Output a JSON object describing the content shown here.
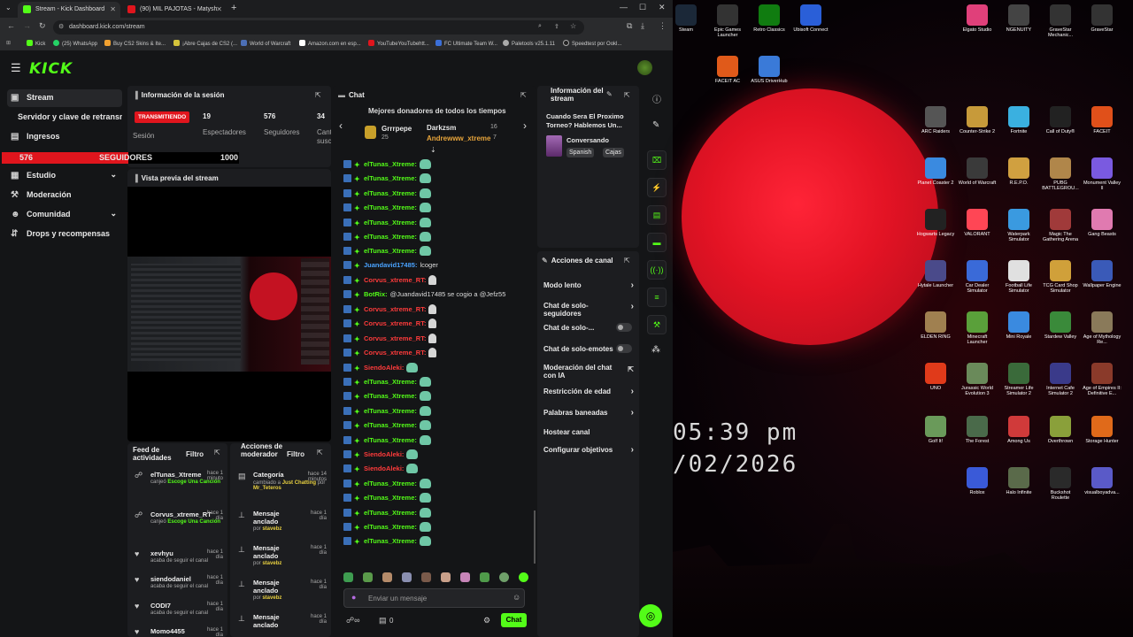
{
  "browser": {
    "tabs": [
      {
        "label": "Stream - Kick Dashboard",
        "active": true
      },
      {
        "label": "(90) MIL PAJOTAS - Matysh",
        "active": false
      }
    ],
    "url": "dashboard.kick.com/stream",
    "bookmarks": [
      "Kick",
      "(25) WhatsApp",
      "Buy CS2 Skins & Ite...",
      "¡Abre Cajas de CS2 (...",
      "World of Warcraft",
      "Amazon.com en esp...",
      "YouTubeYouTubehtt...",
      "FC Ultimate Team W...",
      "Paletools v25.1.11",
      "Speedtest por Ookl..."
    ]
  },
  "sidebar": {
    "items": [
      {
        "label": "Stream",
        "icon": "stream-icon"
      },
      {
        "label": "Servidor y clave de retransmisión",
        "icon": ""
      },
      {
        "label": "Ingresos",
        "icon": "revenue-icon"
      },
      {
        "label": "Estudio",
        "icon": "studio-icon"
      },
      {
        "label": "Moderación",
        "icon": "moderation-icon"
      },
      {
        "label": "Comunidad",
        "icon": "community-icon"
      },
      {
        "label": "Drops y recompensas",
        "icon": "drops-icon"
      }
    ]
  },
  "goal": {
    "current": "576",
    "label": "SEGUIDORES",
    "target": "1000",
    "progress": 0.576
  },
  "session": {
    "title": "Información de la sesión",
    "badge": "TRANSMITIENDO",
    "badge_sub": "Sesión",
    "stats": [
      {
        "value": "19",
        "label": "Espectadores"
      },
      {
        "value": "576",
        "label": "Seguidores"
      },
      {
        "value": "34",
        "label": "Cant suscr"
      }
    ]
  },
  "preview": {
    "title": "Vista previa del stream"
  },
  "feed": {
    "title": "Feed de actividades",
    "filter": "Filtro",
    "items": [
      {
        "name": "elTunas_Xtreme",
        "time": "hace 1 minuto",
        "sub_prefix": "canjeó",
        "sub_hl": "Escoge Una Canción"
      },
      {
        "name": "Corvus_xtreme_RT",
        "time": "hace 1 día",
        "sub_prefix": "canjeó",
        "sub_hl": "Escoge Una Canción"
      },
      {
        "name": "xevhyu",
        "time": "hace 1 día",
        "sub_prefix": "acaba de seguir el canal",
        "sub_hl": ""
      },
      {
        "name": "siendodaniel",
        "time": "hace 1 día",
        "sub_prefix": "acaba de seguir el canal",
        "sub_hl": ""
      },
      {
        "name": "CODI7",
        "time": "hace 1 día",
        "sub_prefix": "acaba de seguir el canal",
        "sub_hl": ""
      },
      {
        "name": "Momo4455",
        "time": "hace 1 día",
        "sub_prefix": "",
        "sub_hl": ""
      }
    ]
  },
  "modactions": {
    "title": "Acciones de moderador",
    "filter": "Filtro",
    "items": [
      {
        "name": "Categoría",
        "time": "hace 14 minutos",
        "sub_a": "cambiado a",
        "sub_b": "Just Chatting",
        "sub_c": "por",
        "sub_d": "Mr_Teteros"
      },
      {
        "name": "Mensaje anclado",
        "time": "hace 1 día",
        "sub_a": "",
        "sub_b": "",
        "sub_c": "por",
        "sub_d": "stavebz"
      },
      {
        "name": "Mensaje anclado",
        "time": "hace 1 día",
        "sub_a": "",
        "sub_b": "",
        "sub_c": "por",
        "sub_d": "stavebz"
      },
      {
        "name": "Mensaje anclado",
        "time": "hace 1 día",
        "sub_a": "",
        "sub_b": "",
        "sub_c": "por",
        "sub_d": "stavebz"
      },
      {
        "name": "Mensaje anclado",
        "time": "hace 1 día",
        "sub_a": "",
        "sub_b": "",
        "sub_c": "",
        "sub_d": ""
      }
    ]
  },
  "chat": {
    "title": "Chat",
    "donors_title": "Mejores donadores de todos los tiempos",
    "donors": [
      {
        "name": "Grrrpepe",
        "amount": "25"
      },
      {
        "name": "Darkzsm",
        "amount": "16"
      },
      {
        "name": "Andrewww_xtreme",
        "amount": "7"
      }
    ],
    "messages": [
      {
        "user": "elTunas_Xtreme",
        "text": "",
        "color": "#53fc18",
        "emote": "frog"
      },
      {
        "user": "elTunas_Xtreme",
        "text": "",
        "color": "#53fc18",
        "emote": "frog"
      },
      {
        "user": "elTunas_Xtreme",
        "text": "",
        "color": "#53fc18",
        "emote": "frog"
      },
      {
        "user": "elTunas_Xtreme",
        "text": "",
        "color": "#53fc18",
        "emote": "frog"
      },
      {
        "user": "elTunas_Xtreme",
        "text": "",
        "color": "#53fc18",
        "emote": "frog"
      },
      {
        "user": "elTunas_Xtreme",
        "text": "",
        "color": "#53fc18",
        "emote": "frog"
      },
      {
        "user": "elTunas_Xtreme",
        "text": "",
        "color": "#53fc18",
        "emote": "frog"
      },
      {
        "user": "Juandavid17485",
        "text": "lcoger",
        "color": "#4aa3ff",
        "emote": ""
      },
      {
        "user": "Corvus_xtreme_RT",
        "text": "",
        "color": "#ff3b3b",
        "emote": "ghost"
      },
      {
        "user": "BotRix",
        "text": "@Juandavid17485 se cogio a @Jefz55",
        "color": "#53fc18",
        "emote": ""
      },
      {
        "user": "Corvus_xtreme_RT",
        "text": "",
        "color": "#ff3b3b",
        "emote": "ghost"
      },
      {
        "user": "Corvus_xtreme_RT",
        "text": "",
        "color": "#ff3b3b",
        "emote": "ghost"
      },
      {
        "user": "Corvus_xtreme_RT",
        "text": "",
        "color": "#ff3b3b",
        "emote": "ghost"
      },
      {
        "user": "Corvus_xtreme_RT",
        "text": "",
        "color": "#ff3b3b",
        "emote": "ghost"
      },
      {
        "user": "SiendoAleki",
        "text": "",
        "color": "#ff3b3b",
        "emote": "frog"
      },
      {
        "user": "elTunas_Xtreme",
        "text": "",
        "color": "#53fc18",
        "emote": "frog"
      },
      {
        "user": "elTunas_Xtreme",
        "text": "",
        "color": "#53fc18",
        "emote": "frog"
      },
      {
        "user": "elTunas_Xtreme",
        "text": "",
        "color": "#53fc18",
        "emote": "frog"
      },
      {
        "user": "elTunas_Xtreme",
        "text": "",
        "color": "#53fc18",
        "emote": "frog"
      },
      {
        "user": "elTunas_Xtreme",
        "text": "",
        "color": "#53fc18",
        "emote": "frog"
      },
      {
        "user": "SiendoAleki",
        "text": "",
        "color": "#ff3b3b",
        "emote": "frog"
      },
      {
        "user": "SiendoAleki",
        "text": "",
        "color": "#ff3b3b",
        "emote": "frog"
      },
      {
        "user": "elTunas_Xtreme",
        "text": "",
        "color": "#53fc18",
        "emote": "frog"
      },
      {
        "user": "elTunas_Xtreme",
        "text": "",
        "color": "#53fc18",
        "emote": "frog"
      },
      {
        "user": "elTunas_Xtreme",
        "text": "",
        "color": "#53fc18",
        "emote": "frog"
      },
      {
        "user": "elTunas_Xtreme",
        "text": "",
        "color": "#53fc18",
        "emote": "frog"
      },
      {
        "user": "elTunas_Xtreme",
        "text": "",
        "color": "#53fc18",
        "emote": "frog"
      }
    ],
    "input_placeholder": "Enviar un mensaje",
    "viewer_count": "0",
    "send_label": "Chat"
  },
  "stream_info": {
    "title": "Información del stream",
    "stream_title": "Cuando Sera El Proximo Torneo? Hablemos Un...",
    "category": "Conversando",
    "tags": [
      "Spanish",
      "Cajas"
    ]
  },
  "channel_actions": {
    "title": "Acciones de canal",
    "items": [
      {
        "label": "Modo lento",
        "type": "chevron"
      },
      {
        "label": "Chat de solo-seguidores",
        "type": "chevron"
      },
      {
        "label": "Chat de solo-...",
        "type": "toggle"
      },
      {
        "label": "Chat de solo-emotes",
        "type": "toggle"
      },
      {
        "label": "Moderación del chat con IA",
        "type": "external"
      },
      {
        "label": "Restricción de edad",
        "type": "chevron"
      },
      {
        "label": "Palabras baneadas",
        "type": "chevron"
      },
      {
        "label": "Hostear canal",
        "type": "none"
      },
      {
        "label": "Configurar objetivos",
        "type": "chevron"
      }
    ]
  },
  "desktop": {
    "clock": "05:39 pm",
    "date": "/02/2026",
    "icons": [
      "Steam",
      "Epic Games Launcher",
      "Retro Classics",
      "Ubisoft Connect",
      "FACEIT AC",
      "ASUS DriverHub",
      "Elgato Studio",
      "NGENUITY",
      "GraveStar Mechanic...",
      "GraveStar",
      "ARC Raiders",
      "Counter-Strike 2",
      "Fortnite",
      "Call of Duty®",
      "FACEIT",
      "Planet Coaster 2",
      "World of Warcraft",
      "R.E.P.O.",
      "PUBG BATTLEGROU...",
      "Monument Valley II",
      "Hogwarts Legacy",
      "VALORANT",
      "Waterpark Simulator",
      "Magic The Gathering Arena",
      "Gang Beasts",
      "Hytale Launcher",
      "Car Dealer Simulator",
      "Football Life Simulator",
      "TCG Card Shop Simulator",
      "Wallpaper Engine",
      "ELDEN RING",
      "Minecraft Launcher",
      "Mini Royale",
      "Stardew Valley",
      "Age of Mythology Re...",
      "UNO",
      "Jurassic World Evolution 3",
      "Streamer Life Simulator 2",
      "Internet Cafe Simulator 2",
      "Age of Empires II: Definitive E...",
      "Golf It!",
      "The Forest",
      "Among Us",
      "Overthrown",
      "Storage Hunter",
      "Roblox",
      "Halo Infinite",
      "Buckshot Roulette",
      "visualboyadva..."
    ]
  }
}
